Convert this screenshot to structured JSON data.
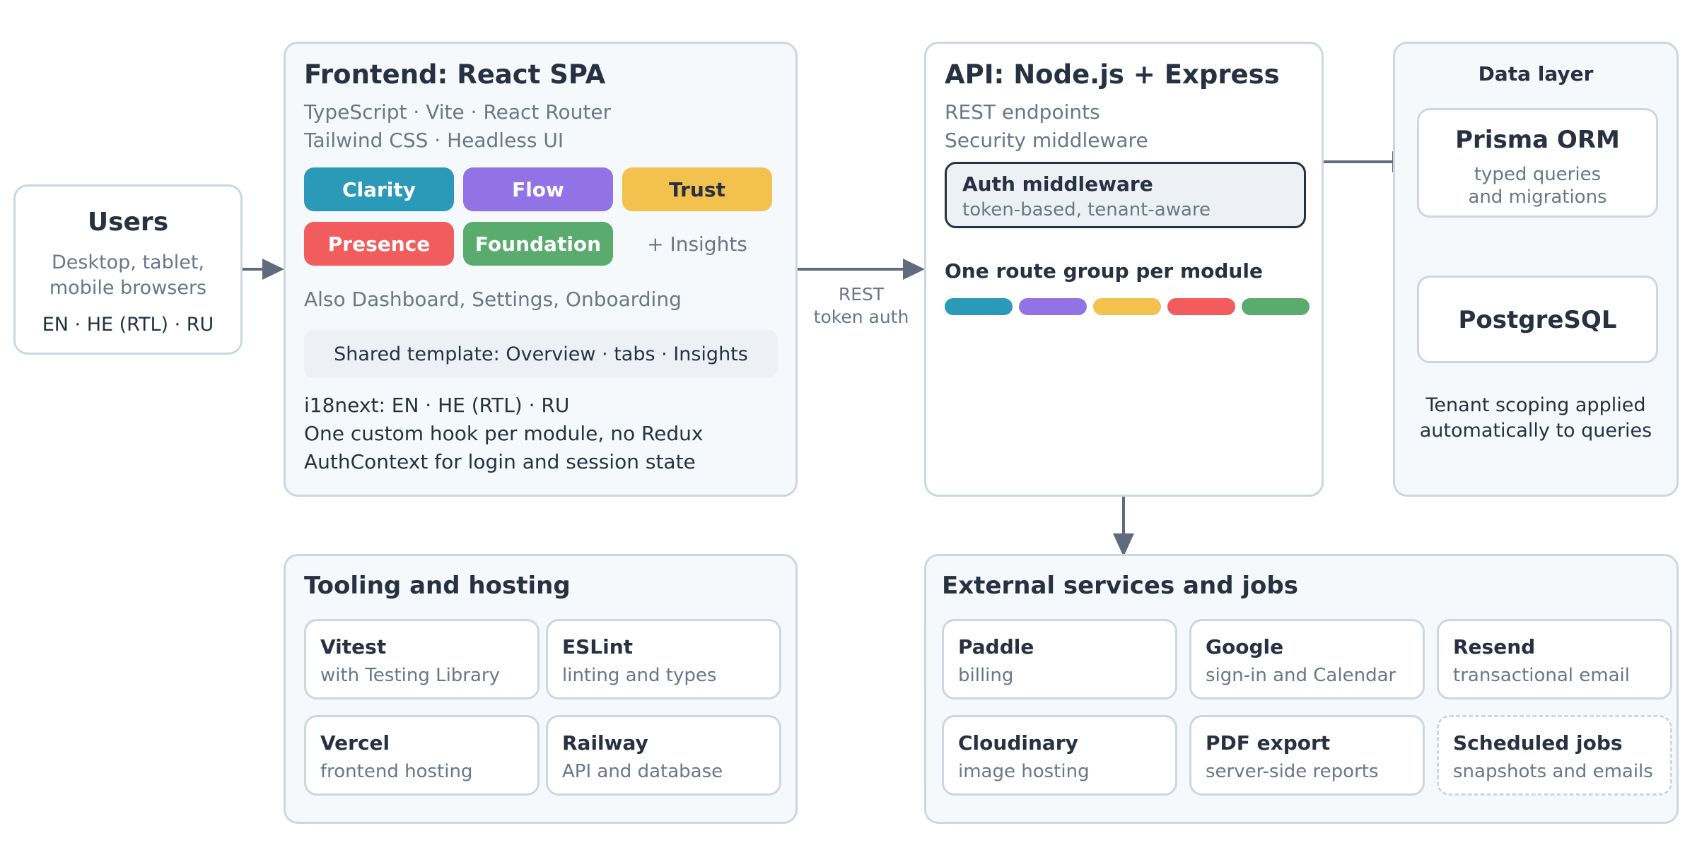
{
  "users": {
    "title": "Users",
    "desc1": "Desktop, tablet,",
    "desc2": "mobile browsers",
    "langs": "EN · HE (RTL) · RU"
  },
  "frontend": {
    "title": "Frontend: React SPA",
    "sub1": "TypeScript · Vite · React Router",
    "sub2": "Tailwind CSS · Headless UI",
    "modules": [
      {
        "label": "Clarity",
        "color": "#2b9ab8"
      },
      {
        "label": "Flow",
        "color": "#9273e6"
      },
      {
        "label": "Trust",
        "color": "#f2c14e"
      },
      {
        "label": "Presence",
        "color": "#f25c5c"
      },
      {
        "label": "Foundation",
        "color": "#5aab6e"
      }
    ],
    "insights": "+ Insights",
    "also": "Also Dashboard, Settings, Onboarding",
    "template": "Shared template: Overview · tabs · Insights",
    "i18n": "i18next: EN · HE (RTL) · RU",
    "hook": "One custom hook per module, no Redux",
    "auth": "AuthContext for login and session state"
  },
  "edge": {
    "rest": "REST",
    "token": "token auth"
  },
  "api": {
    "title": "API: Node.js + Express",
    "sub1": "REST endpoints",
    "sub2": "Security middleware",
    "mw_title": "Auth middleware",
    "mw_sub": "token-based, tenant-aware",
    "route": "One route group per module"
  },
  "data": {
    "title": "Data layer",
    "prisma": "Prisma ORM",
    "prisma_sub1": "typed queries",
    "prisma_sub2": "and migrations",
    "pg": "PostgreSQL",
    "note1": "Tenant scoping applied",
    "note2": "automatically to queries"
  },
  "tooling": {
    "title": "Tooling and hosting",
    "cards": [
      {
        "title": "Vitest",
        "sub": "with Testing Library"
      },
      {
        "title": "ESLint",
        "sub": "linting and types"
      },
      {
        "title": "Vercel",
        "sub": "frontend hosting"
      },
      {
        "title": "Railway",
        "sub": "API and database"
      }
    ]
  },
  "external": {
    "title": "External services and jobs",
    "cards": [
      {
        "title": "Paddle",
        "sub": "billing"
      },
      {
        "title": "Google",
        "sub": "sign-in and Calendar"
      },
      {
        "title": "Resend",
        "sub": "transactional email"
      },
      {
        "title": "Cloudinary",
        "sub": "image hosting"
      },
      {
        "title": "PDF export",
        "sub": "server-side reports"
      },
      {
        "title": "Scheduled jobs",
        "sub": "snapshots and emails"
      }
    ]
  },
  "colors": {
    "box_border": "#cdd6e1",
    "box_fill": "#f6f9fc",
    "arrow": "#5f6b7e",
    "text_dark": "#273142",
    "text_muted": "#6b7686"
  }
}
